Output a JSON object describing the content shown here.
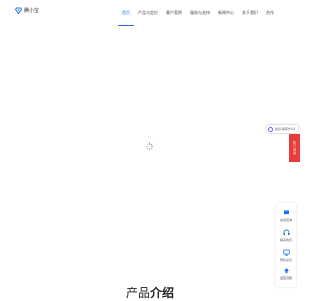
{
  "brand": {
    "name": "腾小宝",
    "color": "#1a73e8"
  },
  "nav": {
    "items": [
      {
        "label": "首页",
        "active": true
      },
      {
        "label": "产品与定价",
        "active": false
      },
      {
        "label": "客户案例",
        "active": false
      },
      {
        "label": "服务与支持",
        "active": false
      },
      {
        "label": "新闻中心",
        "active": false
      },
      {
        "label": "关于我们",
        "active": false
      },
      {
        "label": "合作",
        "active": false
      }
    ]
  },
  "loading": {
    "icon": "spinner-icon"
  },
  "chat": {
    "label": "您好,我有什么能帮您?",
    "icon": "chat-icon"
  },
  "promo": {
    "label": "热门活动",
    "color": "#e83b3b"
  },
  "sidebar": {
    "items": [
      {
        "label": "在线咨询",
        "icon": "chat-bubble-icon"
      },
      {
        "label": "联系我们",
        "icon": "headset-icon"
      },
      {
        "label": "预约演示",
        "icon": "screen-icon"
      },
      {
        "label": "返回顶部",
        "icon": "arrow-up-icon"
      }
    ]
  },
  "section": {
    "title_prefix": "产品",
    "title_strong": "介绍"
  }
}
